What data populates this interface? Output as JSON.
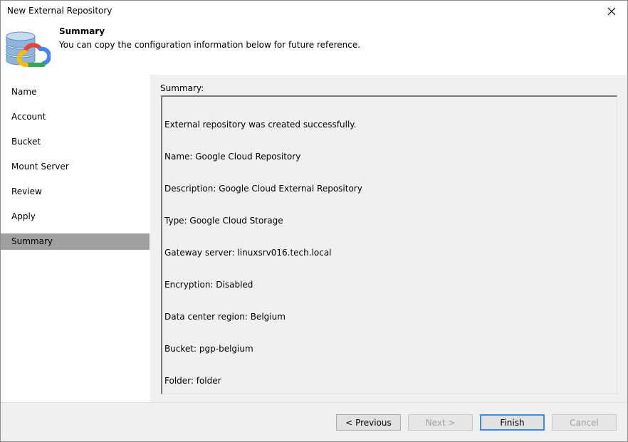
{
  "window": {
    "title": "New External Repository"
  },
  "header": {
    "title": "Summary",
    "description": "You can copy the configuration information below for future reference."
  },
  "sidebar": {
    "steps": [
      {
        "label": "Name"
      },
      {
        "label": "Account"
      },
      {
        "label": "Bucket"
      },
      {
        "label": "Mount Server"
      },
      {
        "label": "Review"
      },
      {
        "label": "Apply"
      },
      {
        "label": "Summary"
      }
    ],
    "active_step": "Summary"
  },
  "content": {
    "summary_label": "Summary:",
    "summary_lines": [
      "External repository was created successfully.",
      "Name: Google Cloud Repository",
      "Description: Google Cloud External Repository",
      "Type: Google Cloud Storage",
      "Gateway server: linuxsrv016.tech.local",
      "Encryption: Disabled",
      "Data center region: Belgium",
      "Bucket: pgp-belgium",
      "Folder: folder"
    ]
  },
  "footer": {
    "previous_label": "< Previous",
    "next_label": "Next >",
    "finish_label": "Finish",
    "cancel_label": "Cancel"
  },
  "colors": {
    "active_step_bg": "#a0a0a0",
    "google_red": "#ea4335",
    "google_yellow": "#fbbc04",
    "google_green": "#34a853",
    "google_blue": "#4285f4",
    "database_blue": "#8fb4dc"
  }
}
